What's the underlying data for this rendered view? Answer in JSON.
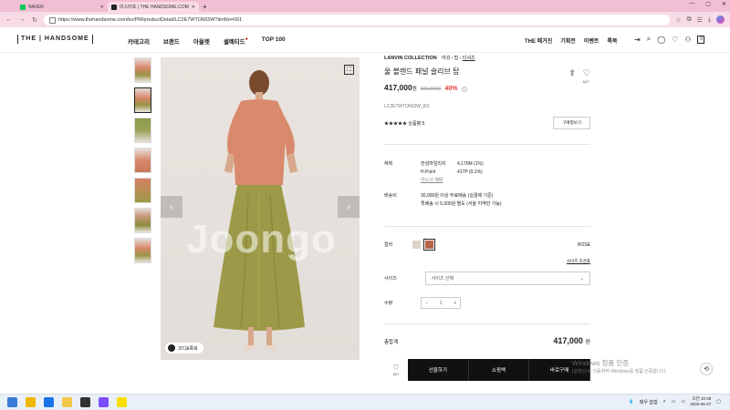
{
  "browser": {
    "tabs": [
      {
        "title": "NAVER",
        "active": false,
        "favicon_color": "#03c75a"
      },
      {
        "title": "미스터프 | THE HANDSOME.COM",
        "active": true,
        "favicon_color": "#222222"
      }
    ],
    "url": "https://www.thehandsome.com/ko/PM/productDetail/LC2E7WTO603W?itmNo=001",
    "new_tab_glyph": "+"
  },
  "header": {
    "logo": "THE | HANDSOME",
    "nav": [
      "카테고리",
      "브랜드",
      "아울렛",
      "셀렉티드",
      "TOP 100"
    ],
    "nav_badge_index": 3,
    "util_links": [
      "THE 매거진",
      "기획전",
      "이벤트",
      "룩북"
    ],
    "bag_count": "0"
  },
  "gallery": {
    "watermark": "Joongo",
    "view_button": "코디&룩북",
    "thumb_count": 7
  },
  "product": {
    "brand": "LANVIN COLLECTION",
    "breadcrumb": [
      "여성",
      "탑",
      "티셔츠"
    ],
    "name": "울 블렌드 패널 슬리브 탑",
    "like_count": "117",
    "price": "417,000",
    "price_unit": "원",
    "original_price": "695,000원",
    "discount": "40%",
    "code": "LC2E7WTO603W_RS",
    "stars": "★★★★★",
    "review_label": "상품평 5",
    "review_button": "구매평보기"
  },
  "benefit": {
    "label": "혜택",
    "rows": [
      {
        "name": "한섬마일리지",
        "value": "4,170M (1%)"
      },
      {
        "name": "H.Point",
        "value": "417P (0.1%)"
      }
    ],
    "card_link": "카드사 혜택",
    "delivery_label": "배송비",
    "delivery_lines": [
      "30,000원 이상 무료배송 (실결제 기준)",
      "퀵배송 시 5,000원 별도 (서울 지역만 가능)"
    ]
  },
  "options": {
    "color_label": "컬러",
    "swatches": [
      "#dcd4c8",
      "#b8624a"
    ],
    "selected_color": "ROSE",
    "size_guide": "사이즈 조견표",
    "size_label": "사이즈",
    "size_placeholder": "사이즈 선택",
    "qty_label": "수량",
    "qty_value": "1"
  },
  "total": {
    "label": "총합계",
    "value": "417,000",
    "unit": "원"
  },
  "actions": {
    "like_count": "117",
    "buttons": [
      "선물하기",
      "쇼핑백",
      "바로구매"
    ]
  },
  "activation": {
    "title": "Windows 정품 인증",
    "subtitle": "[설정]으로 이동하여 Windows를 정품 인증합니다."
  },
  "taskbar": {
    "weather": "매우 습함",
    "time": "오전 10:39",
    "date": "2025-06-27",
    "icons": [
      "#f0b800",
      "#3a7bd5",
      "#1a73e8",
      "#6b3fa0",
      "#333333",
      "#7b4fff",
      "#f9e000"
    ]
  }
}
